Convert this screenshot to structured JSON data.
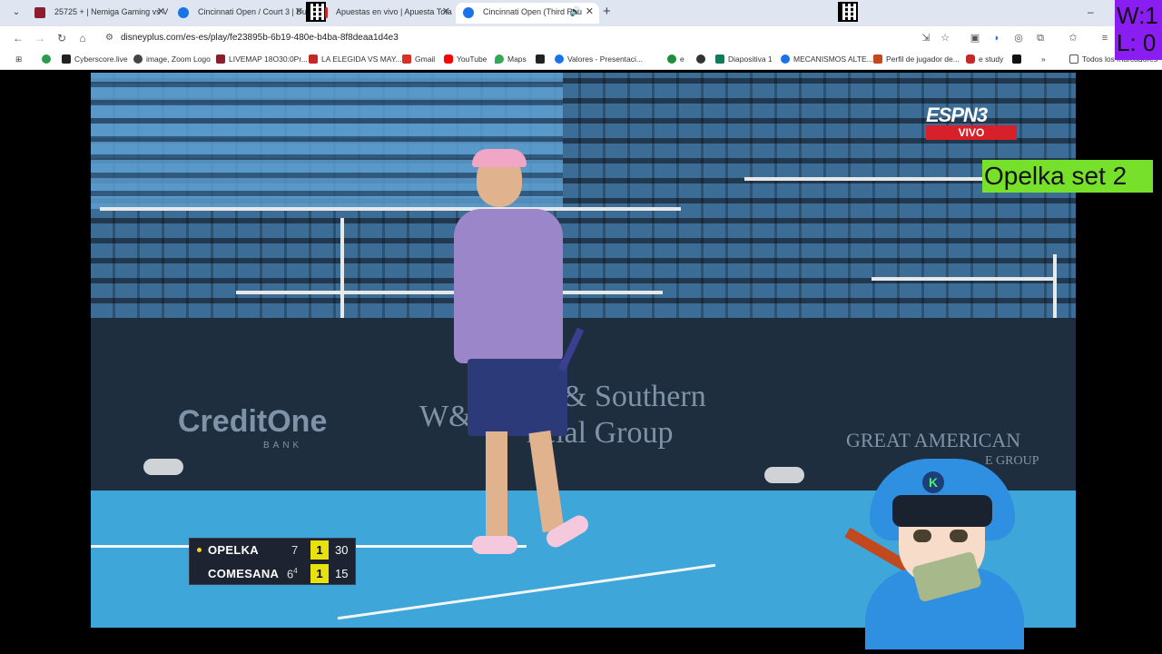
{
  "browser": {
    "tabs": [
      {
        "title": "25725 + | Nemiga Gaming vs V",
        "favicon_color": "#8b1d2c"
      },
      {
        "title": "Cincinnati Open / Court 3 | Du",
        "favicon_color": "#1a73e8"
      },
      {
        "title": "Apuestas en vivo | Apuesta Tota",
        "favicon_color": "#c62828"
      },
      {
        "title": "Cincinnati Open (Third Rou",
        "favicon_color": "#1a73e8",
        "active": true
      }
    ],
    "new_tab_glyph": "+",
    "url": "disneyplus.com/es-es/play/fe23895b-6b19-480e-b4ba-8f8deaa1d4e3",
    "window_controls": [
      "–",
      "▢",
      "✕"
    ],
    "bookmarks": [
      {
        "label": "Cyberscore.live",
        "color": "#222"
      },
      {
        "label": "image, Zoom Logo",
        "color": "#444"
      },
      {
        "label": "LIVEMAP 18O30:0Pr...",
        "color": "#8b1d2c"
      },
      {
        "label": "LA ELEGIDA VS MAY...",
        "color": "#c62828"
      },
      {
        "label": "Gmail",
        "color": "#d93025"
      },
      {
        "label": "YouTube",
        "color": "#ff0000"
      },
      {
        "label": "Maps",
        "color": "#34a853"
      },
      {
        "label": "",
        "color": "#222"
      },
      {
        "label": "Valores - Presentaci...",
        "color": "#1a73e8"
      },
      {
        "label": "e",
        "color": "#1e8e3e"
      },
      {
        "label": "",
        "color": "#333"
      },
      {
        "label": "Diapositiva 1",
        "color": "#0f7a5c"
      },
      {
        "label": "MECANISMOS ALTE...",
        "color": "#1a73e8"
      },
      {
        "label": "Perfil de jugador de...",
        "color": "#c2481e"
      },
      {
        "label": "e study",
        "color": "#c62828"
      },
      {
        "label": "",
        "color": "#111"
      }
    ],
    "bookmarks_overflow": "»",
    "all_bookmarks": "Todos los marcadores"
  },
  "overlay": {
    "win_loss": {
      "w": "W:1",
      "l": "L: 0"
    },
    "set_label": "Opelka set 2"
  },
  "broadcast": {
    "channel": "ESPN3",
    "live_label": "VIVO",
    "sponsors": {
      "credit_one": "CreditOne",
      "credit_one_sub": "BANK",
      "western_southern_1": "& Southern",
      "western_southern_2": "ncial Group",
      "ws_logo": "W&S",
      "great_american_1": "GREAT AMERICAN",
      "great_american_2": "E GROUP"
    },
    "scoreboard": {
      "players": [
        {
          "name": "OPELKA",
          "set1": "7",
          "set1_tb": "",
          "set2": "1",
          "points": "30",
          "serving": true
        },
        {
          "name": "COMESANA",
          "set1": "6",
          "set1_tb": "4",
          "set2": "1",
          "points": "15",
          "serving": false
        }
      ]
    }
  },
  "colors": {
    "overlay_purple": "#8a1df2",
    "overlay_green": "#76e02b",
    "live_red": "#d8202a",
    "court_blue": "#3ea6d8",
    "set_highlight": "#e8e10e"
  }
}
